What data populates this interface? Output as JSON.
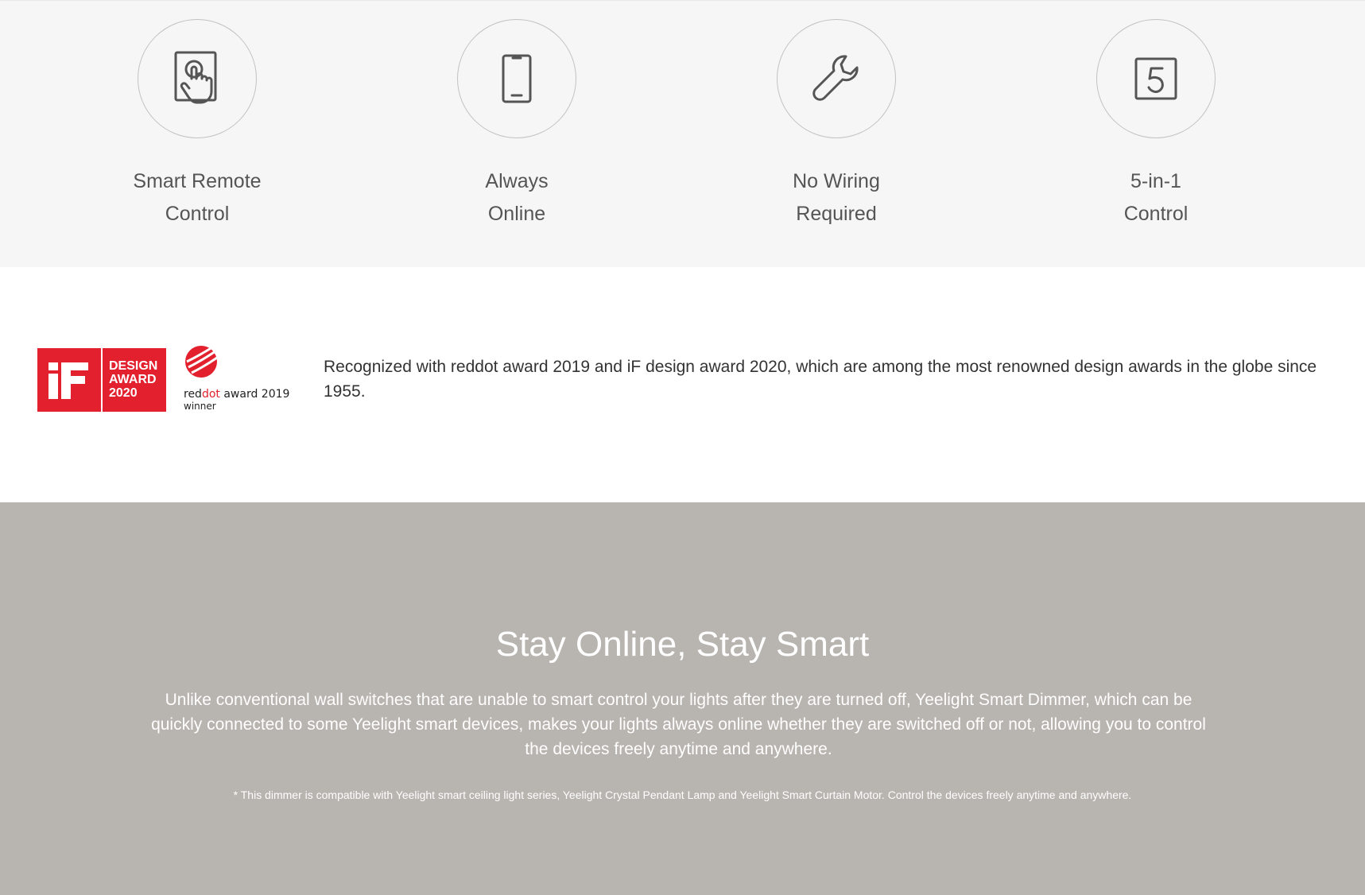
{
  "features": [
    {
      "icon": "touch-hand-icon",
      "line1": "Smart Remote",
      "line2": "Control"
    },
    {
      "icon": "smartphone-icon",
      "line1": "Always",
      "line2": "Online"
    },
    {
      "icon": "wrench-icon",
      "line1": "No Wiring",
      "line2": "Required"
    },
    {
      "icon": "five-in-box-icon",
      "line1": "5-in-1",
      "line2": "Control"
    }
  ],
  "awards": {
    "if_logo_text": "DESIGN AWARD 2020",
    "reddot_logo_text": "reddot award 2019",
    "reddot_logo_sub": "winner",
    "text": "Recognized with reddot award 2019 and iF design award 2020, which are among the most renowned design awards in the globe since 1955."
  },
  "online": {
    "title": "Stay Online, Stay Smart",
    "description": "Unlike conventional wall switches that are unable to smart control your lights after they are turned off, Yeelight Smart Dimmer, which can be quickly connected to some Yeelight smart devices, makes your lights always online whether they are switched off or not, allowing you to control the devices freely anytime and anywhere.",
    "note": "* This dimmer is compatible with Yeelight smart ceiling light series, Yeelight Crystal Pendant Lamp and Yeelight Smart Curtain Motor. Control the devices freely anytime and anywhere."
  },
  "colors": {
    "features_bg": "#f6f6f6",
    "online_bg": "#b8b4af",
    "award_red": "#e2202e"
  }
}
